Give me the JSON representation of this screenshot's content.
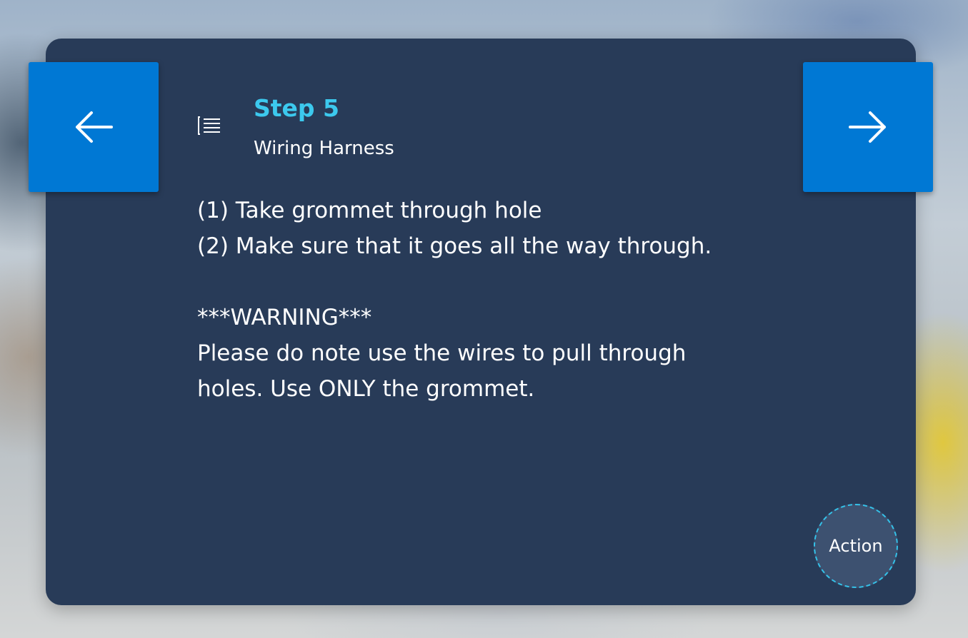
{
  "step": {
    "title": "Step 5",
    "subtitle": "Wiring Harness"
  },
  "instructions": {
    "line1": "(1) Take grommet through hole",
    "line2": "(2) Make sure that it goes all the way through.",
    "warning_heading": "***WARNING***",
    "warning_text": "Please do note use the wires to pull through holes. Use ONLY the grommet."
  },
  "navigation": {
    "previous_icon": "arrow-left-icon",
    "next_icon": "arrow-right-icon",
    "list_icon": "bulleted-list-icon"
  },
  "action": {
    "label": "Action"
  },
  "colors": {
    "card_background": "#283b58",
    "nav_button": "#0078d4",
    "step_title": "#3cc9ee",
    "action_border": "#35c1e8"
  }
}
